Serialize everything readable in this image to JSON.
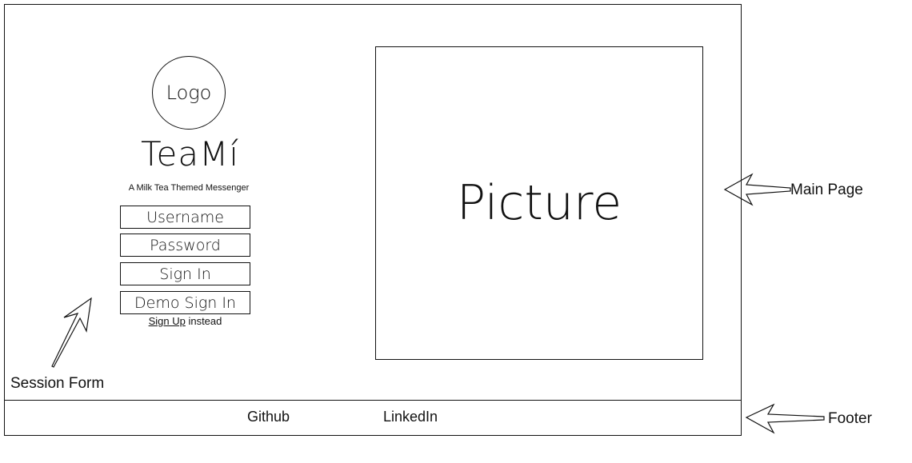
{
  "logo": {
    "label": "Logo"
  },
  "app": {
    "title": "TeaMí",
    "tagline": "A Milk Tea Themed Messenger"
  },
  "session_form": {
    "username_placeholder": "Username",
    "password_placeholder": "Password",
    "sign_in_label": "Sign In",
    "demo_sign_in_label": "Demo Sign In",
    "sign_up_link": "Sign Up",
    "sign_up_suffix": " instead"
  },
  "picture": {
    "label": "Picture"
  },
  "footer": {
    "links": [
      "Github",
      "LinkedIn"
    ]
  },
  "annotations": {
    "session_form": "Session Form",
    "main_page": "Main Page",
    "footer": "Footer"
  }
}
